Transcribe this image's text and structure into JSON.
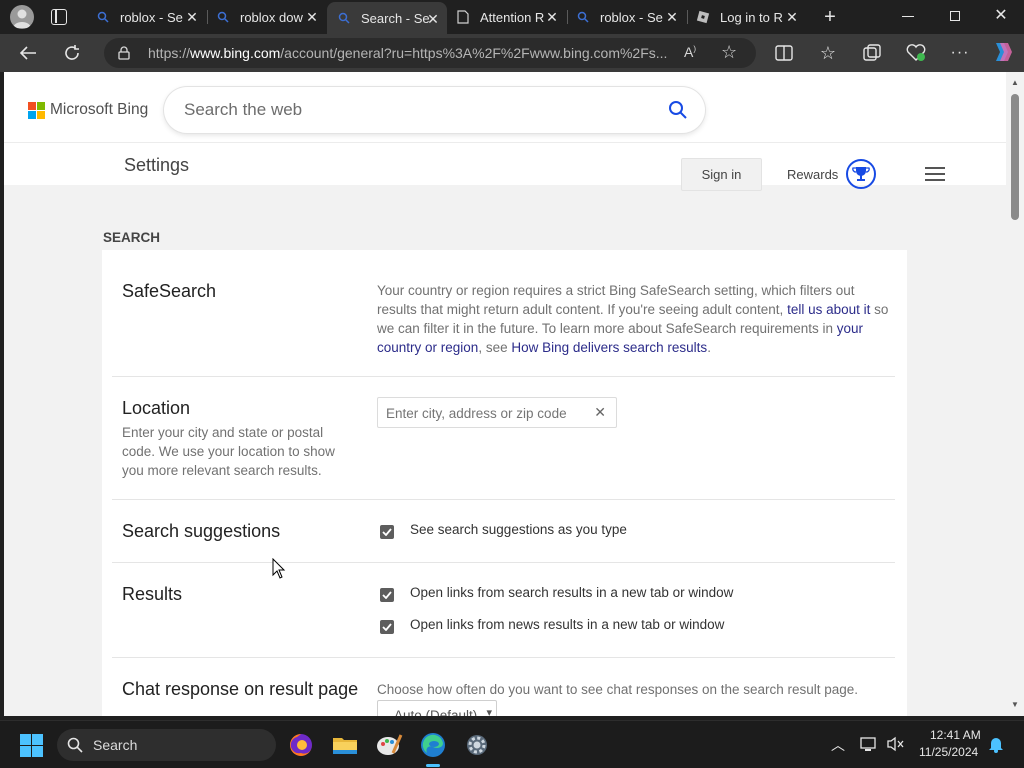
{
  "browser": {
    "tabs": [
      {
        "title": "roblox - Se",
        "icon": "search-icon",
        "active": false
      },
      {
        "title": "roblox dow",
        "icon": "search-icon",
        "active": false
      },
      {
        "title": "Search - Se",
        "icon": "search-icon",
        "active": true
      },
      {
        "title": "Attention R",
        "icon": "page-icon",
        "active": false
      },
      {
        "title": "roblox - Se",
        "icon": "search-icon",
        "active": false
      },
      {
        "title": "Log in to R",
        "icon": "roblox-icon",
        "active": false
      }
    ],
    "url_prefix": "https://",
    "url_domain": "www.bing.com",
    "url_rest": "/account/general?ru=https%3A%2F%2Fwww.bing.com%2Fs..."
  },
  "bing": {
    "logo_text": "Microsoft Bing",
    "search_placeholder": "Search the web",
    "settings_title": "Settings",
    "sign_in": "Sign in",
    "rewards": "Rewards",
    "section_heading": "SEARCH"
  },
  "sections": {
    "safesearch": {
      "title": "SafeSearch",
      "desc_parts": [
        {
          "text": "Your country or region requires a strict Bing SafeSearch setting, which filters out results that might return adult content. If you're seeing adult content, ",
          "link": false
        },
        {
          "text": "tell us about it",
          "link": true
        },
        {
          "text": " so we can filter it in the future. To learn more about SafeSearch requirements in ",
          "link": false
        },
        {
          "text": "your country or region",
          "link": true
        },
        {
          "text": ", see ",
          "link": false
        },
        {
          "text": "How Bing delivers search results",
          "link": true
        },
        {
          "text": ".",
          "link": false
        }
      ]
    },
    "location": {
      "title": "Location",
      "desc": "Enter your city and state or postal code. We use your location to show you more relevant search results.",
      "placeholder": "Enter city, address or zip code"
    },
    "suggestions": {
      "title": "Search suggestions",
      "option": "See search suggestions as you type",
      "checked": true
    },
    "results": {
      "title": "Results",
      "option1": "Open links from search results in a new tab or window",
      "option1_checked": true,
      "option2": "Open links from news results in a new tab or window",
      "option2_checked": true
    },
    "chat": {
      "title": "Chat response on result page",
      "desc": "Choose how often do you want to see chat responses on the search result page.",
      "select_value": "Auto (Default)"
    }
  },
  "taskbar": {
    "search_label": "Search",
    "time": "12:41 AM",
    "date": "11/25/2024",
    "apps": [
      "firefox-icon",
      "file-explorer-icon",
      "paint-icon",
      "edge-icon",
      "settings-icon"
    ]
  },
  "colors": {
    "bing_link": "#2c2c8a",
    "search_icon_blue": "#174ae4",
    "edge_accent": "#2a8fd8"
  }
}
